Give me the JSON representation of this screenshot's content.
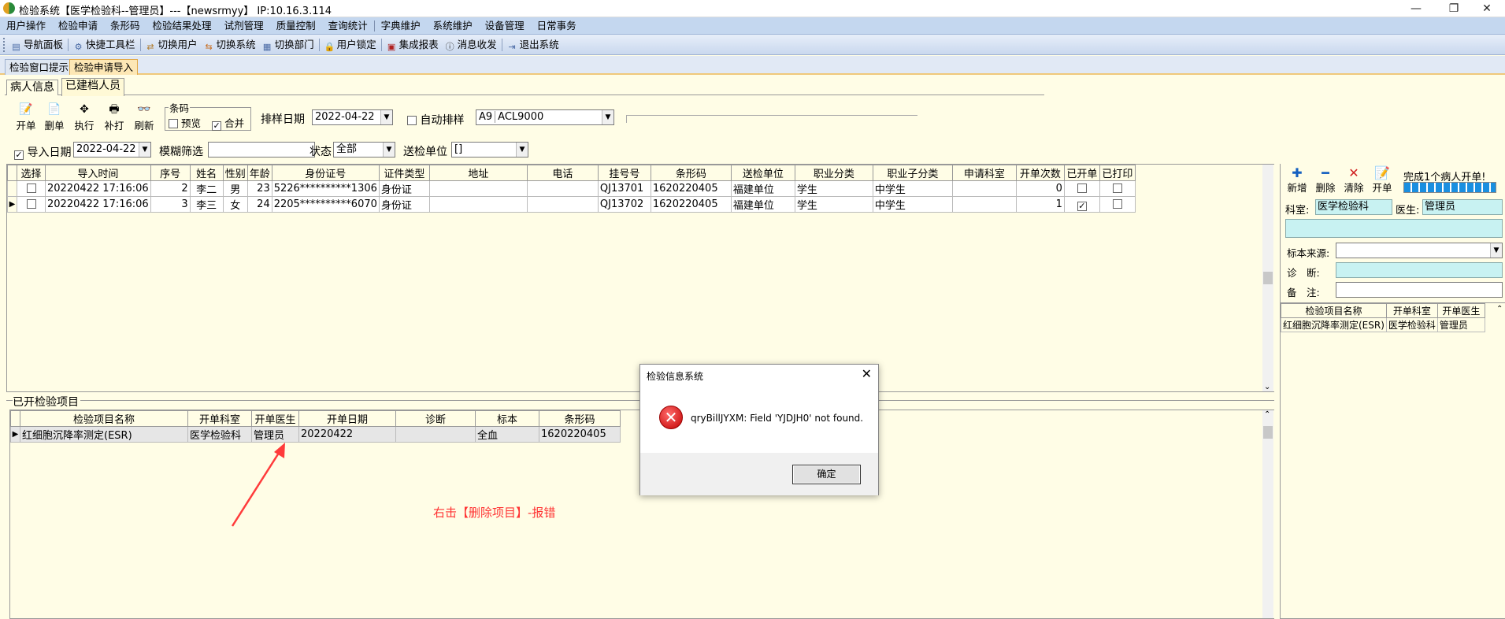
{
  "window": {
    "title": "检验系统【医学检验科--管理员】---【newsrmyy】 IP:10.16.3.114",
    "controls": [
      "—",
      "❐",
      "✕"
    ]
  },
  "menubar": [
    "用户操作",
    "检验申请",
    "条形码",
    "检验结果处理",
    "试剂管理",
    "质量控制",
    "查询统计",
    "字典维护",
    "系统维护",
    "设备管理",
    "日常事务"
  ],
  "toolbar": [
    {
      "label": "导航面板",
      "icon": "navigation-panel-icon"
    },
    {
      "label": "快捷工具栏",
      "icon": "quick-toolbar-icon"
    },
    {
      "label": "切换用户",
      "icon": "switch-user-icon"
    },
    {
      "label": "切换系统",
      "icon": "switch-system-icon"
    },
    {
      "label": "切换部门",
      "icon": "switch-department-icon"
    },
    {
      "label": "用户锁定",
      "icon": "user-lock-icon"
    },
    {
      "label": "集成报表",
      "icon": "report-icon"
    },
    {
      "label": "消息收发",
      "icon": "message-icon"
    },
    {
      "label": "退出系统",
      "icon": "exit-icon"
    }
  ],
  "doc_tabs": [
    "检验窗口提示",
    "检验申请导入"
  ],
  "inner_tabs": [
    "病人信息",
    "已建档人员"
  ],
  "actions": [
    "开单",
    "删单",
    "执行",
    "补打",
    "刷新"
  ],
  "barcode_group": {
    "title": "条码",
    "preview": "预览",
    "merge": "合并",
    "merge_checked": true
  },
  "schedule": {
    "date_label": "排样日期",
    "date_value": "2022-04-22",
    "auto_label": "自动排样",
    "device_code": "A9",
    "device_name": "ACL9000"
  },
  "filters": {
    "import_date_label": "导入日期",
    "import_date_checked": true,
    "import_date_value": "2022-04-22",
    "fuzzy_label": "模糊筛选",
    "fuzzy_value": "",
    "status_label": "状态",
    "status_value": "全部",
    "unit_label": "送检单位",
    "unit_value": "[]"
  },
  "patients": {
    "columns": [
      "选择",
      "导入时间",
      "序号",
      "姓名",
      "性别",
      "年龄",
      "身份证号",
      "证件类型",
      "地址",
      "电话",
      "挂号号",
      "条形码",
      "送检单位",
      "职业分类",
      "职业子分类",
      "申请科室",
      "开单次数",
      "已开单",
      "已打印"
    ],
    "rows": [
      {
        "time": "20220422 17:16:06",
        "seq": "2",
        "name": "李二",
        "sex": "男",
        "age": "23",
        "id": "5226**********1306",
        "id_type": "身份证",
        "address": "",
        "phone": "",
        "reg": "QJ13701",
        "barcode": "1620220405",
        "unit": "福建单位",
        "job": "学生",
        "subjob": "中学生",
        "dept": "",
        "count": "0",
        "opened": false,
        "printed": false
      },
      {
        "time": "20220422 17:16:06",
        "seq": "3",
        "name": "李三",
        "sex": "女",
        "age": "24",
        "id": "2205**********6070",
        "id_type": "身份证",
        "address": "",
        "phone": "",
        "reg": "QJ13702",
        "barcode": "1620220405",
        "unit": "福建单位",
        "job": "学生",
        "subjob": "中学生",
        "dept": "",
        "count": "1",
        "opened": true,
        "printed": false
      }
    ]
  },
  "opened_items": {
    "title": "已开检验项目",
    "columns": [
      "检验项目名称",
      "开单科室",
      "开单医生",
      "开单日期",
      "诊断",
      "标本",
      "条形码"
    ],
    "rows": [
      {
        "name": "红细胞沉降率测定(ESR)",
        "dept": "医学检验科",
        "doctor": "管理员",
        "date": "20220422",
        "diag": "",
        "specimen": "全血",
        "barcode": "1620220405"
      }
    ]
  },
  "annotation": {
    "text": "右击【删除项目】-报错",
    "color": "#ff3333"
  },
  "right_panel": {
    "buttons": [
      {
        "label": "新增",
        "icon": "plus-icon",
        "color": "#1560c0"
      },
      {
        "label": "删除",
        "icon": "minus-icon",
        "color": "#1560c0"
      },
      {
        "label": "清除",
        "icon": "clear-x-icon",
        "color": "#d02020"
      },
      {
        "label": "开单",
        "icon": "open-order-icon",
        "color": "#333333"
      }
    ],
    "status": "完成1个病人开单!",
    "progress": 1.0,
    "dept_label": "科室:",
    "dept_value": "医学检验科",
    "doctor_label": "医生:",
    "doctor_value": "管理员",
    "source_label": "标本来源:",
    "diagnosis_label": "诊　断:",
    "remark_label": "备　注:",
    "grid_columns": [
      "检验项目名称",
      "开单科室",
      "开单医生"
    ],
    "grid_rows": [
      {
        "name": "红细胞沉降率测定(ESR)",
        "dept": "医学检验科",
        "doctor": "管理员"
      }
    ]
  },
  "dialog": {
    "title": "检验信息系统",
    "message": "qryBillJYXM: Field 'YJDJH0' not found.",
    "ok": "确定",
    "close": "✕"
  }
}
